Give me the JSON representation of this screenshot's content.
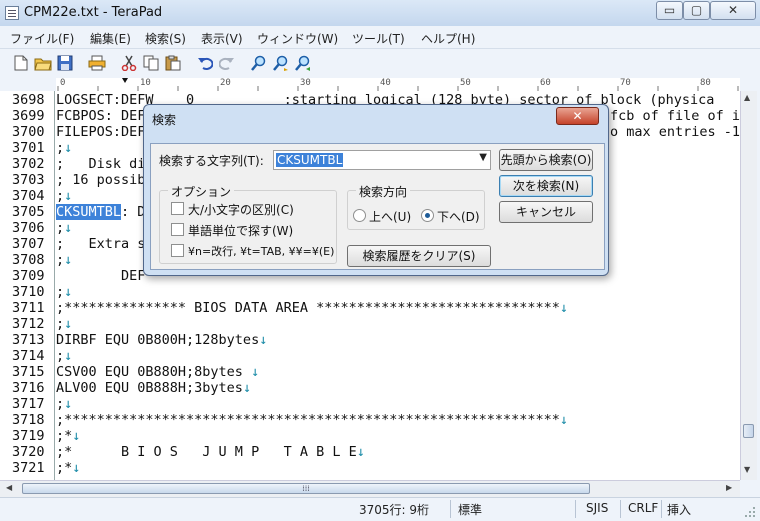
{
  "window": {
    "title": "CPM22e.txt - TeraPad",
    "controls": {
      "minimize": "▭",
      "maximize": "▢",
      "close": "✕"
    }
  },
  "menu": [
    "ファイル(F)",
    "編集(E)",
    "検索(S)",
    "表示(V)",
    "ウィンドウ(W)",
    "ツール(T)",
    "ヘルプ(H)"
  ],
  "toolbar": {
    "icons": [
      "new-file-icon",
      "open-folder-icon",
      "save-icon",
      "print-icon",
      "cut-icon",
      "copy-icon",
      "paste-icon",
      "undo-icon",
      "redo-icon",
      "find-icon",
      "find-next-icon",
      "find-prev-icon"
    ]
  },
  "ruler": {
    "marks": [
      "0",
      "10",
      "20",
      "30",
      "40",
      "50",
      "60",
      "70",
      "80"
    ]
  },
  "editor": {
    "lines": [
      {
        "num": "3698",
        "pre": "LOGSECT:DEFW    0           ;starting logical (128 byte) sector of block (physica",
        "sel": "",
        "post": "",
        "eol": ""
      },
      {
        "num": "3699",
        "pre": "FCBPOS: DEF",
        "sel": "",
        "post": "",
        "eol": ""
      },
      {
        "num": "3700",
        "pre": "FILEPOS:DEF",
        "sel": "",
        "post": "",
        "eol": ""
      },
      {
        "num": "3701",
        "pre": ";",
        "sel": "",
        "post": "",
        "eol": "↓"
      },
      {
        "num": "3702",
        "pre": ";   Disk di",
        "sel": "",
        "post": "",
        "eol": ""
      },
      {
        "num": "3703",
        "pre": "; 16 possib",
        "sel": "",
        "post": "",
        "eol": ""
      },
      {
        "num": "3704",
        "pre": ";",
        "sel": "",
        "post": "",
        "eol": "↓"
      },
      {
        "num": "3705",
        "pre": "",
        "sel": "CKSUMTBL",
        "post": ": D",
        "eol": ""
      },
      {
        "num": "3706",
        "pre": ";",
        "sel": "",
        "post": "",
        "eol": "↓"
      },
      {
        "num": "3707",
        "pre": ";   Extra s",
        "sel": "",
        "post": "",
        "eol": ""
      },
      {
        "num": "3708",
        "pre": ";",
        "sel": "",
        "post": "",
        "eol": "↓"
      },
      {
        "num": "3709",
        "pre": "        DEF",
        "sel": "",
        "post": "",
        "eol": ""
      },
      {
        "num": "3710",
        "pre": ";",
        "sel": "",
        "post": "",
        "eol": "↓"
      },
      {
        "num": "3711",
        "pre": ";*************** BIOS DATA AREA ******************************",
        "sel": "",
        "post": "",
        "eol": "↓"
      },
      {
        "num": "3712",
        "pre": ";",
        "sel": "",
        "post": "",
        "eol": "↓"
      },
      {
        "num": "3713",
        "pre": "DIRBF EQU 0B800H;128bytes",
        "sel": "",
        "post": "",
        "eol": "↓"
      },
      {
        "num": "3714",
        "pre": ";",
        "sel": "",
        "post": "",
        "eol": "↓"
      },
      {
        "num": "3715",
        "pre": "CSV00 EQU 0B880H;8bytes ",
        "sel": "",
        "post": "",
        "eol": "↓"
      },
      {
        "num": "3716",
        "pre": "ALV00 EQU 0B888H;3bytes",
        "sel": "",
        "post": "",
        "eol": "↓"
      },
      {
        "num": "3717",
        "pre": ";",
        "sel": "",
        "post": "",
        "eol": "↓"
      },
      {
        "num": "3718",
        "pre": ";*************************************************************",
        "sel": "",
        "post": "",
        "eol": "↓"
      },
      {
        "num": "3719",
        "pre": ";*",
        "sel": "",
        "post": "",
        "eol": "↓"
      },
      {
        "num": "3720",
        "pre": ";*      B I O S   J U M P   T A B L E",
        "sel": "",
        "post": "",
        "eol": "↓"
      },
      {
        "num": "3721",
        "pre": ";*",
        "sel": "",
        "post": "",
        "eol": "↓"
      }
    ],
    "right_fragments": [
      {
        "text": "fcb of file of i",
        "row": 1
      },
      {
        "text": "o max entries -1",
        "row": 2
      }
    ]
  },
  "statusbar": {
    "position": "3705行:  9桁",
    "mode": "標準",
    "encoding": "SJIS",
    "newline": "CRLF",
    "insert": "挿入"
  },
  "dialog": {
    "title": "検索",
    "close": "✕",
    "search_label": "検索する文字列(T):",
    "search_value": "CKSUMTBL",
    "btn_from_top": "先頭から検索(O)",
    "btn_next": "次を検索(N)",
    "btn_cancel": "キャンセル",
    "btn_clear": "検索履歴をクリア(S)",
    "options_title": "オプション",
    "options": [
      "大/小文字の区別(C)",
      "単語単位で探す(W)",
      "¥n=改行, ¥t=TAB, ¥¥=¥(E)"
    ],
    "direction_title": "検索方向",
    "dir_up": "上へ(U)",
    "dir_down": "下へ(D)",
    "selected_direction": "down"
  }
}
